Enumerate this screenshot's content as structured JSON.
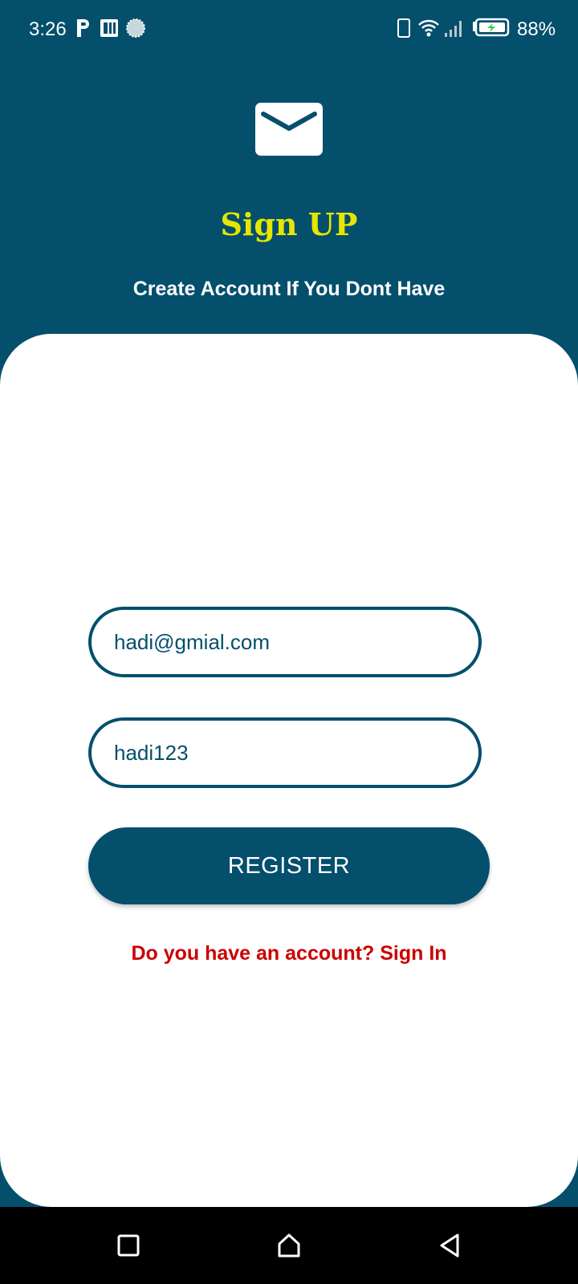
{
  "status_bar": {
    "time": "3:26",
    "battery_percent": "88%",
    "icons": [
      "parking-icon",
      "app-icon",
      "sync-icon",
      "phone-icon",
      "wifi-icon",
      "signal-icon",
      "battery-charging-icon"
    ]
  },
  "header": {
    "icon": "mail-icon",
    "title": "Sign UP",
    "subtitle": "Create Account If You Dont Have"
  },
  "form": {
    "email_value": "hadi@gmial.com",
    "password_value": "hadi123",
    "register_label": "REGISTER",
    "signin_link": "Do you have an account? Sign In"
  },
  "nav_bar": {
    "icons": [
      "recents-icon",
      "home-icon",
      "back-icon"
    ]
  },
  "colors": {
    "primary": "#034f6c",
    "title": "#e6e600",
    "link": "#cc0000",
    "card": "#ffffff"
  }
}
